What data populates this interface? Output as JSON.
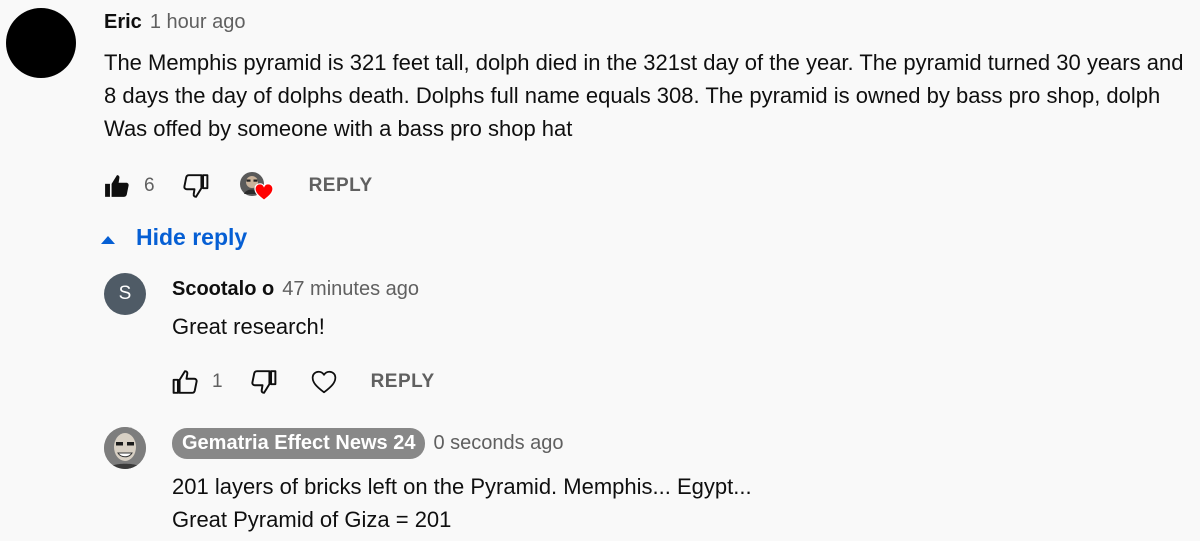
{
  "comment": {
    "author": "Eric",
    "time": "1 hour ago",
    "text": "The Memphis pyramid is 321 feet tall, dolph died in the 321st day of the year. The pyramid turned 30 years and 8 days the day of dolphs death. Dolphs full name equals 308. The pyramid is owned by bass pro shop, dolph Was offed by someone with a bass pro shop hat",
    "likes": "6",
    "reply_label": "REPLY",
    "like_icon": "thumbs-up-filled-icon",
    "dislike_icon": "thumbs-down-icon",
    "creator_heart": "creator-heart-avatar",
    "heart_color": "#ff0000"
  },
  "hide_reply": {
    "label": "Hide reply",
    "icon": "caret-up-icon",
    "color": "#065fd4"
  },
  "replies": [
    {
      "author": "Scootalo o",
      "avatar_letter": "S",
      "time": "47 minutes ago",
      "text": "Great research!",
      "likes": "1",
      "reply_label": "REPLY",
      "avatar_color": "#4f5b66"
    },
    {
      "author": "Gematria Effect News 24",
      "time": "0 seconds ago",
      "lines": [
        "201 layers of bricks left on the Pyramid.  Memphis... Egypt...",
        "Great Pyramid of Giza = 201"
      ],
      "badge_color": "#888888"
    }
  ]
}
